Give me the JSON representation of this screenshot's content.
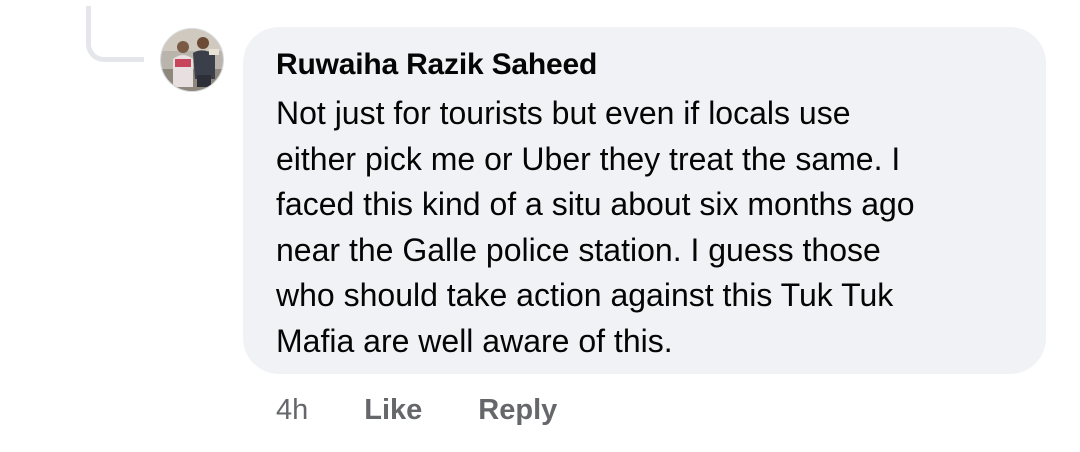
{
  "comment": {
    "author": "Ruwaiha Razik Saheed",
    "avatar_icon": "user-photo-avatar",
    "text_lines": [
      "Not just for tourists but even if locals use",
      "either pick me or Uber they treat the same. I",
      "faced this kind of a situ about six months ago",
      "near the Galle police station. I guess those",
      "who should take action against this Tuk Tuk",
      "Mafia are well aware of this."
    ],
    "timestamp": "4h",
    "like_label": "Like",
    "reply_label": "Reply"
  },
  "colors": {
    "bubble_bg": "#f0f2f5",
    "text": "#050505",
    "meta": "#65676b",
    "connector": "#e4e6eb"
  }
}
